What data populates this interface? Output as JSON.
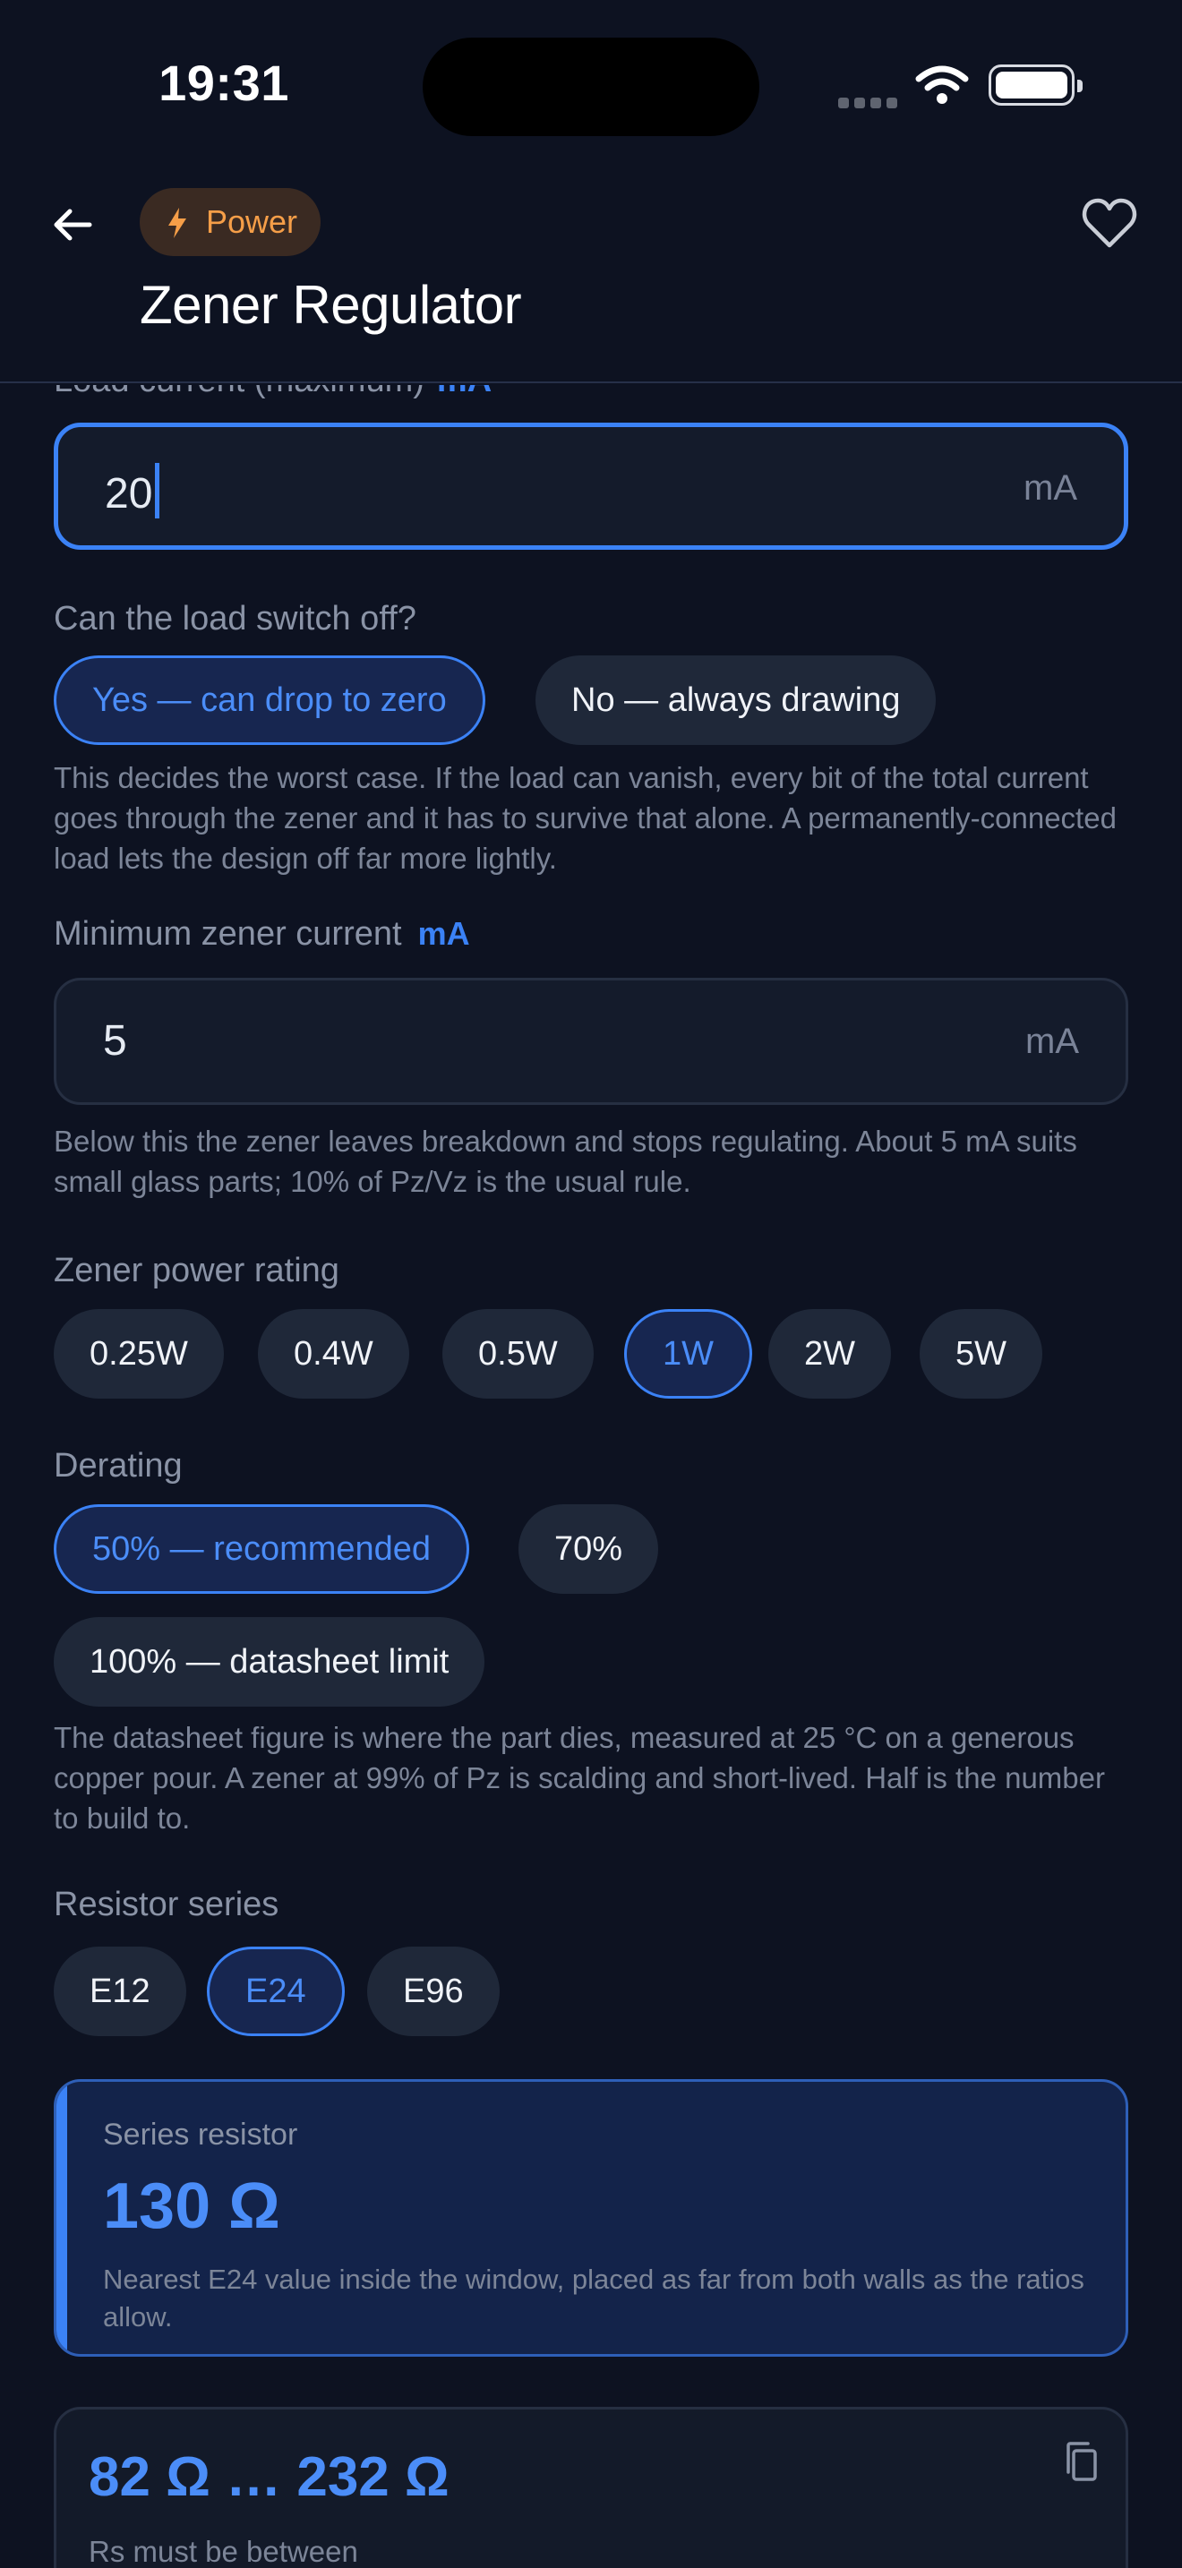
{
  "status": {
    "time": "19:31"
  },
  "header": {
    "category": "Power",
    "title": "Zener Regulator"
  },
  "load_current": {
    "label": "Load current (maximum)",
    "unit": "mA",
    "value": "20",
    "suffix": "mA"
  },
  "switch_off": {
    "label": "Can the load switch off?",
    "options": [
      "Yes — can drop to zero",
      "No — always drawing"
    ],
    "selected": "Yes — can drop to zero",
    "help": "This decides the worst case. If the load can vanish, every bit of the total current goes through the zener and it has to survive that alone. A permanently-connected load lets the design off far more lightly."
  },
  "min_zener_current": {
    "label": "Minimum zener current",
    "unit": "mA",
    "value": "5",
    "suffix": "mA",
    "help": "Below this the zener leaves breakdown and stops regulating. About 5 mA suits small glass parts; 10% of Pz/Vz is the usual rule."
  },
  "power_rating": {
    "label": "Zener power rating",
    "options": [
      "0.25W",
      "0.4W",
      "0.5W",
      "1W",
      "2W",
      "5W"
    ],
    "selected": "1W"
  },
  "derating": {
    "label": "Derating",
    "options": [
      "50% — recommended",
      "70%",
      "100% — datasheet limit"
    ],
    "selected": "50% — recommended",
    "help": "The datasheet figure is where the part dies, measured at 25 °C on a generous copper pour. A zener at 99% of Pz is scalding and short-lived. Half is the number to build to."
  },
  "resistor_series": {
    "label": "Resistor series",
    "options": [
      "E12",
      "E24",
      "E96"
    ],
    "selected": "E24"
  },
  "result": {
    "label": "Series resistor",
    "value": "130 Ω",
    "note": "Nearest E24 value inside the window, placed as far from both walls as the ratios allow."
  },
  "range": {
    "value": "82 Ω … 232 Ω",
    "caption": "Rs must be between"
  },
  "colors": {
    "accent": "#3b82f6",
    "power_badge": "#f59e48",
    "background": "#0d1221"
  }
}
